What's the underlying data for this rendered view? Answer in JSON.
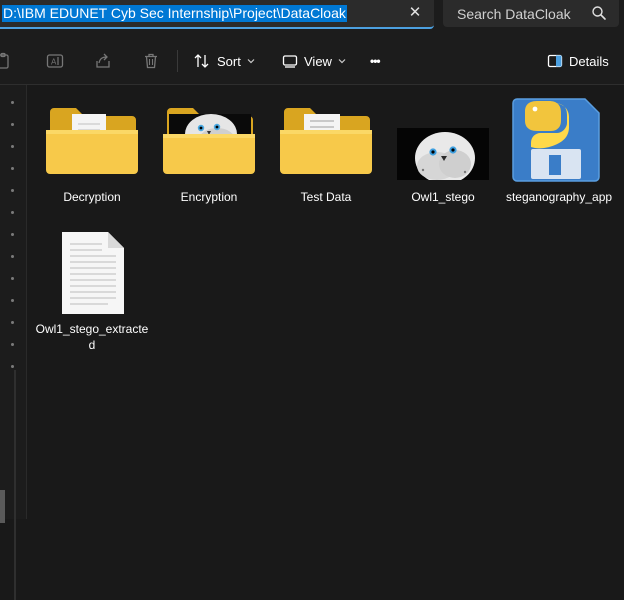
{
  "address_bar": {
    "path": "D:\\IBM EDUNET Cyb Sec Internship\\Project\\DataCloak"
  },
  "search": {
    "placeholder": "Search DataCloak"
  },
  "toolbar": {
    "sort_label": "Sort",
    "view_label": "View",
    "more_label": "•••",
    "details_label": "Details"
  },
  "files": [
    {
      "name": "Decryption",
      "type": "folder"
    },
    {
      "name": "Encryption",
      "type": "folder-with-image"
    },
    {
      "name": "Test Data",
      "type": "folder"
    },
    {
      "name": "Owl1_stego",
      "type": "image"
    },
    {
      "name": "steganography_app",
      "type": "python-file"
    },
    {
      "name": "Owl1_stego_extracted",
      "type": "text-file"
    }
  ],
  "colors": {
    "selection": "#0078d4",
    "background": "#191919",
    "folder": "#f5c242"
  }
}
